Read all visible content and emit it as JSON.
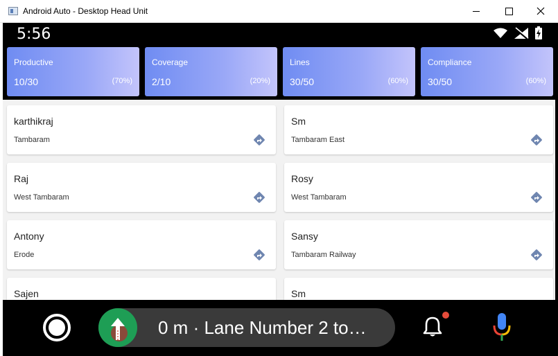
{
  "window": {
    "title": "Android Auto - Desktop Head Unit"
  },
  "status": {
    "time": "5:56"
  },
  "stats": [
    {
      "label": "Productive",
      "value": "10/30",
      "pct": "(70%)"
    },
    {
      "label": "Coverage",
      "value": "2/10",
      "pct": "(20%)"
    },
    {
      "label": "Lines",
      "value": "30/50",
      "pct": "(60%)"
    },
    {
      "label": "Compliance",
      "value": "30/50",
      "pct": "(60%)"
    }
  ],
  "contacts": [
    {
      "name": "karthikraj",
      "place": "Tambaram"
    },
    {
      "name": "Sm",
      "place": "Tambaram East"
    },
    {
      "name": "Raj",
      "place": "West Tambaram"
    },
    {
      "name": "Rosy",
      "place": "West Tambaram"
    },
    {
      "name": "Antony",
      "place": "Erode"
    },
    {
      "name": "Sansy",
      "place": "Tambaram Railway"
    },
    {
      "name": "Sajen",
      "place": ""
    },
    {
      "name": "Sm",
      "place": ""
    }
  ],
  "navigation": {
    "instruction": "0 m · Lane Number 2 to…"
  },
  "colors": {
    "stat_gradient_start": "#6f8cf2",
    "stat_gradient_end": "#c3c4fb",
    "nav_green": "#1e9e55",
    "notification_dot": "#e44b3a"
  },
  "icons": [
    "app-icon",
    "wifi-icon",
    "no-signal-icon",
    "battery-icon",
    "directions-icon",
    "home-icon",
    "turn-straight-icon",
    "notification-bell-icon",
    "microphone-icon"
  ]
}
